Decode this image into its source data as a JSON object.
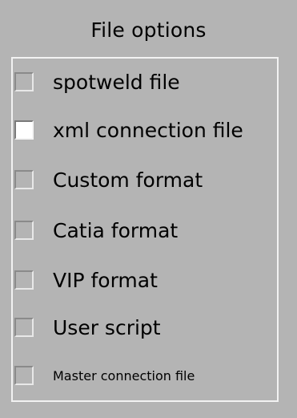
{
  "panel": {
    "title": "File options"
  },
  "options": [
    {
      "label": "spotweld file",
      "checked": false
    },
    {
      "label": "xml connection file",
      "checked": true
    },
    {
      "label": "Custom format",
      "checked": false
    },
    {
      "label": "Catia format",
      "checked": false
    },
    {
      "label": "VIP format",
      "checked": false
    },
    {
      "label": "User script",
      "checked": false
    },
    {
      "label": "Master connection file",
      "checked": false
    }
  ]
}
